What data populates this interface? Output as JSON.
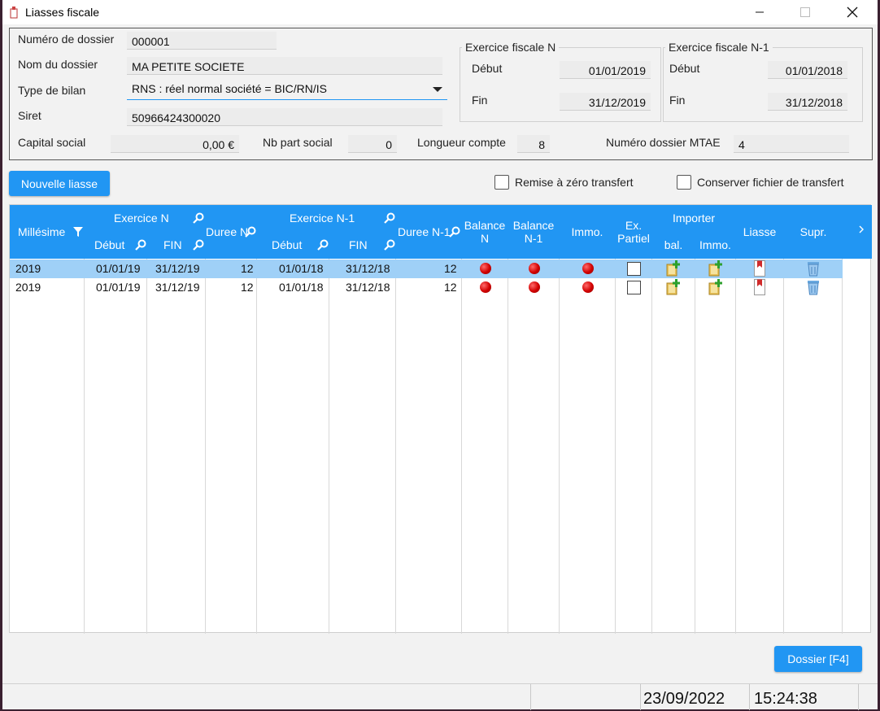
{
  "window": {
    "title": "Liasses fiscale"
  },
  "dossier": {
    "numero_label": "Numéro de dossier",
    "numero_value": "000001",
    "nom_label": "Nom du dossier",
    "nom_value": "MA PETITE SOCIETE",
    "type_label": "Type de bilan",
    "type_value": "RNS : réel normal société = BIC/RN/IS",
    "siret_label": "Siret",
    "siret_value": "50966424300020",
    "capital_label": "Capital social",
    "capital_value": "0,00 €",
    "nbpart_label": "Nb part social",
    "nbpart_value": "0",
    "longueur_label": "Longueur compte",
    "longueur_value": "8",
    "mtae_label": "Numéro dossier MTAE",
    "mtae_value": "4"
  },
  "exercice_n": {
    "title": "Exercice fiscale N",
    "debut_label": "Début",
    "debut_value": "01/01/2019",
    "fin_label": "Fin",
    "fin_value": "31/12/2019"
  },
  "exercice_n1": {
    "title": "Exercice fiscale N-1",
    "debut_label": "Début",
    "debut_value": "01/01/2018",
    "fin_label": "Fin",
    "fin_value": "31/12/2018"
  },
  "actions": {
    "nouvelle_liasse": "Nouvelle liasse",
    "remise_zero": "Remise à zéro transfert",
    "conserver_fichier": "Conserver fichier de transfert",
    "dossier_button": "Dossier [F4]"
  },
  "table": {
    "headers": {
      "millesime": "Millésime",
      "exercice_n": "Exercice N",
      "debut": "Début",
      "fin": "FIN",
      "duree_n": "Duree N",
      "exercice_n1": "Exercice N-1",
      "debut_n1": "Début",
      "fin_n1": "FIN",
      "duree_n1": "Duree N-1",
      "balance_n_1": "Balance",
      "balance_n_2": "N",
      "balance_n1_1": "Balance",
      "balance_n1_2": "N-1",
      "immo": "Immo.",
      "ex_partiel_1": "Ex.",
      "ex_partiel_2": "Partiel",
      "importer": "Importer",
      "importer_bal": "bal.",
      "importer_immo": "Immo.",
      "liasse": "Liasse",
      "supr": "Supr."
    },
    "rows": [
      {
        "millesime": "2019",
        "debut": "01/01/19",
        "fin": "31/12/19",
        "duree": "12",
        "debut_n1": "01/01/18",
        "fin_n1": "31/12/18",
        "duree_n1": "12",
        "selected": true
      },
      {
        "millesime": "2019",
        "debut": "01/01/19",
        "fin": "31/12/19",
        "duree": "12",
        "debut_n1": "01/01/18",
        "fin_n1": "31/12/18",
        "duree_n1": "12",
        "selected": false
      }
    ]
  },
  "status": {
    "date": "23/09/2022",
    "time": "15:24:38"
  },
  "colors": {
    "accent": "#2196f3",
    "selected_row": "#9fd0f7",
    "status_dot": "#d20000"
  }
}
